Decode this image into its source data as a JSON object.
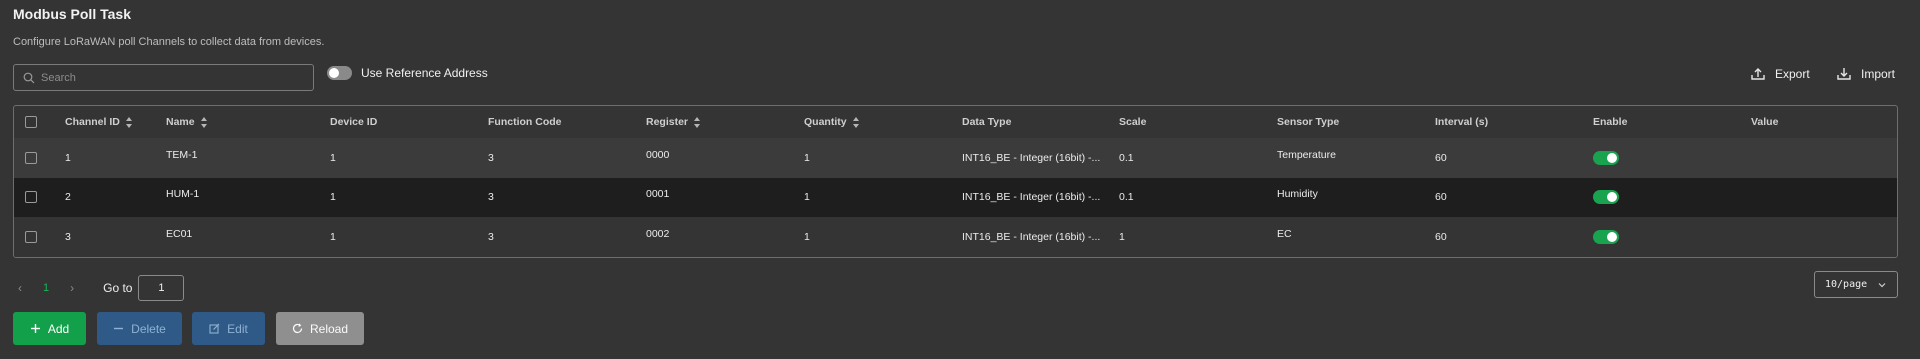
{
  "page": {
    "title": "Modbus Poll Task",
    "subtitle": "Configure LoRaWAN poll Channels to collect data from devices."
  },
  "toolbar": {
    "search_placeholder": "Search",
    "reference_address_label": "Use Reference Address",
    "reference_address_enabled": false,
    "export_label": "Export",
    "import_label": "Import"
  },
  "table": {
    "columns": [
      "Channel ID",
      "Name",
      "Device ID",
      "Function Code",
      "Register",
      "Quantity",
      "Data Type",
      "Scale",
      "Sensor Type",
      "Interval (s)",
      "Enable",
      "Value"
    ],
    "rows": [
      {
        "channel_id": "1",
        "name": "TEM-1",
        "device_id": "1",
        "function_code": "3",
        "register": "0000",
        "quantity": "1",
        "data_type": "INT16_BE - Integer (16bit) -...",
        "scale": "0.1",
        "sensor_type": "Temperature",
        "interval": "60",
        "enabled": true,
        "value": ""
      },
      {
        "channel_id": "2",
        "name": "HUM-1",
        "device_id": "1",
        "function_code": "3",
        "register": "0001",
        "quantity": "1",
        "data_type": "INT16_BE - Integer (16bit) -...",
        "scale": "0.1",
        "sensor_type": "Humidity",
        "interval": "60",
        "enabled": true,
        "value": ""
      },
      {
        "channel_id": "3",
        "name": "EC01",
        "device_id": "1",
        "function_code": "3",
        "register": "0002",
        "quantity": "1",
        "data_type": "INT16_BE - Integer (16bit) -...",
        "scale": "1",
        "sensor_type": "EC",
        "interval": "60",
        "enabled": true,
        "value": ""
      }
    ]
  },
  "pagination": {
    "current_page": "1",
    "goto_label": "Go to",
    "goto_value": "1",
    "page_size": "10/page"
  },
  "actions": {
    "add_label": "Add",
    "delete_label": "Delete",
    "edit_label": "Edit",
    "reload_label": "Reload"
  },
  "colors": {
    "background": "#343434",
    "accent_green": "#13a04b",
    "action_blue": "#2f5a87",
    "reload_gray": "#8f8f8f"
  },
  "icons": {
    "search": "search-icon",
    "export": "upload-icon",
    "import": "download-icon",
    "add": "plus-icon",
    "delete": "minus-icon",
    "edit": "edit-icon",
    "reload": "refresh-icon",
    "page_prev": "chevron-left-icon",
    "page_next": "chevron-right-icon",
    "page_size": "chevron-down-icon"
  }
}
